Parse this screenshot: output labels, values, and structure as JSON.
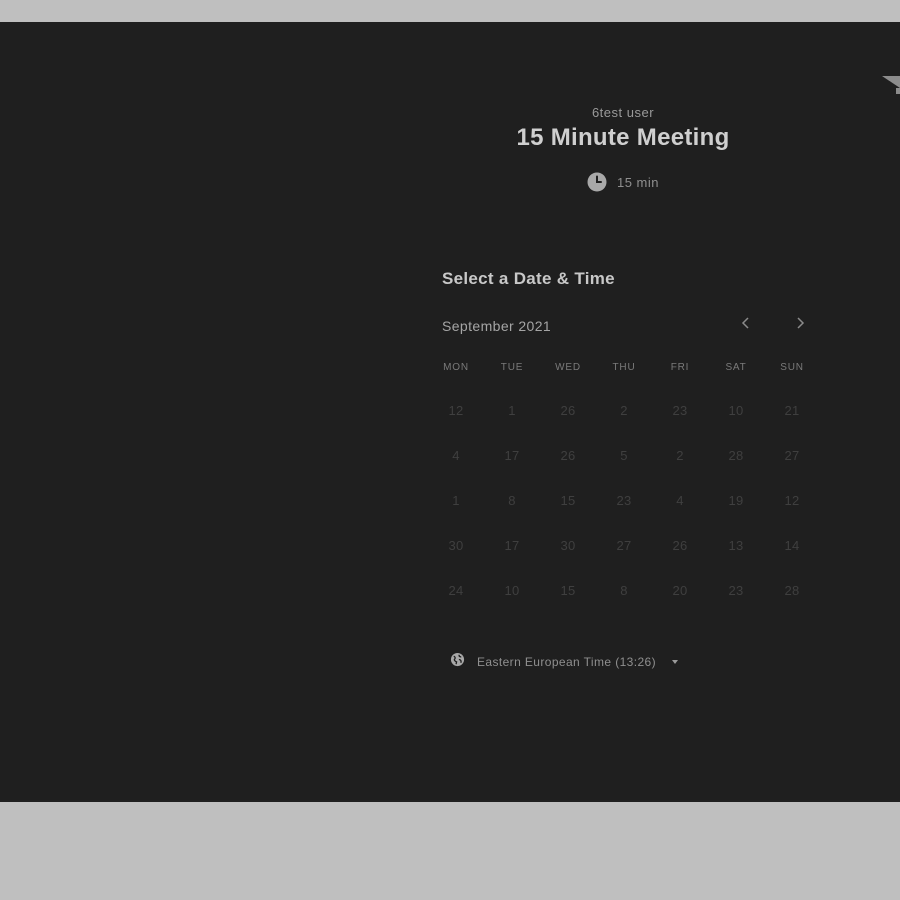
{
  "event": {
    "host": "6test user",
    "title": "15 Minute Meeting",
    "duration": "15 min"
  },
  "calendar": {
    "heading": "Select a Date & Time",
    "month": "September 2021",
    "prev_icon": "chevron-left-icon",
    "next_icon": "chevron-right-icon",
    "weekdays": [
      "MON",
      "TUE",
      "WED",
      "THU",
      "FRI",
      "SAT",
      "SUN"
    ],
    "weeks": [
      [
        "12",
        "1",
        "26",
        "2",
        "23",
        "10",
        "21"
      ],
      [
        "4",
        "17",
        "26",
        "5",
        "2",
        "28",
        "27"
      ],
      [
        "1",
        "8",
        "15",
        "23",
        "4",
        "19",
        "12"
      ],
      [
        "30",
        "17",
        "30",
        "27",
        "26",
        "13",
        "14"
      ],
      [
        "24",
        "10",
        "15",
        "8",
        "20",
        "23",
        "28"
      ]
    ]
  },
  "timezone": {
    "label": "Eastern European Time (13:26)",
    "icon": "globe-icon"
  },
  "colors": {
    "page_background": "#bfbfbf",
    "panel_background": "#1f1f1f",
    "title_text": "#cfcfcf",
    "muted_text": "#8f8f8f",
    "disabled_day": "#3f3f3f"
  }
}
